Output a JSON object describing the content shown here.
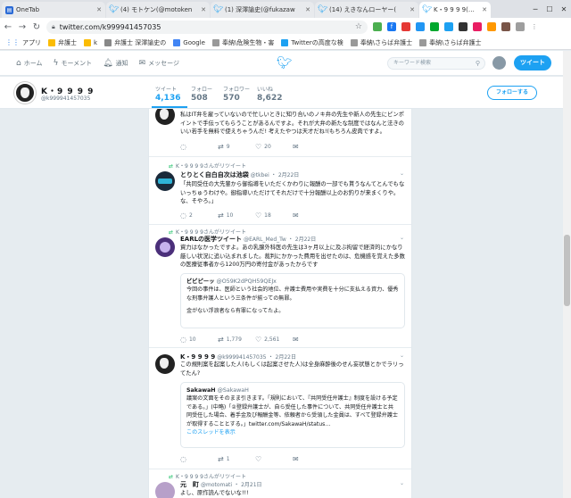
{
  "browser": {
    "tabs": [
      {
        "title": "OneTab",
        "icon": "onetab-icon",
        "active": false
      },
      {
        "title": "(4) モトケン(@motoken",
        "icon": "twitter-bird-icon",
        "active": false
      },
      {
        "title": "(1) 深澤諭史(@fukazaw",
        "icon": "twitter-bird-icon",
        "active": false
      },
      {
        "title": "(14) えきなんローヤー(",
        "icon": "twitter-bird-icon",
        "active": false
      },
      {
        "title": "K・9 9 9 9(@k99994145",
        "icon": "twitter-bird-icon",
        "active": true
      }
    ],
    "url": "twitter.com/k999941457035",
    "bookmarks": [
      "アプリ",
      "弁護士",
      "k",
      "弁護士 深澤諭史の",
      "Google",
      "奉納\\危険生物・害",
      "Twitterの高度な検",
      "奉納\\さらば弁護士",
      "奉納\\さらば弁護士"
    ]
  },
  "twitter_nav": {
    "home": "ホーム",
    "moments": "モーメント",
    "notifications": "通知",
    "messages": "メッセージ",
    "search_placeholder": "キーワード検索",
    "tweet_button": "ツイート"
  },
  "profile": {
    "name": "K・9 9 9 9",
    "handle": "@k999941457035",
    "stats": [
      {
        "label": "ツイート",
        "value": "4,136"
      },
      {
        "label": "フォロー",
        "value": "508"
      },
      {
        "label": "フォロワー",
        "value": "570"
      },
      {
        "label": "いいね",
        "value": "8,622"
      }
    ],
    "follow_button": "フォローする"
  },
  "tweets": [
    {
      "text": "私はIT弁を雇っていないので忙しいときに知り合いのノキ弁の先生や新人の先生にピンポイントで手伝ってもらうことがあるんですよ。それが大弁の新たな制度ではなんと法きのいい若手を無料で使えちゃうんだ! 考えたやつは天才だね!(もちろん皮肉ですよ。",
      "replies": "",
      "retweets": "9",
      "likes": "20"
    },
    {
      "retweeted_by": "K・9 9 9 9さんがリツイート",
      "name": "とりとく自白自次は池袋",
      "handle": "@tkbei",
      "date": "2月22日",
      "text": "「共同受任の大先輩から御指導をいただくかわりに報酬の一部でも貰うなんてとんでもないっちゅうわけや。御指導いただけてそれだけで十分報酬以上のお釣りが来まくりや。な、そやろ。」",
      "replies": "2",
      "retweets": "10",
      "likes": "18"
    },
    {
      "retweeted_by": "K・9 9 9 9さんがリツイート",
      "name": "EARLの医学ツイート",
      "handle": "@EARL_Med_Tw",
      "date": "2月22日",
      "text": "資力はなかったですよ。あの乳腺外科医の先生は3ヶ月以上に及ぶ拘留で経済的にかなり厳しい状況に追い込まれました。裁判にかかった費用を出せたのは、危機感を覚えた多数の医療従事者から1200万円の寄付金があったからです",
      "quote_name": "ビビピーッ",
      "quote_handle": "@O59K2dPQH59QEJx",
      "quote_text": "今回の事件は、医師という社会的地位、弁護士費用や実費を十分に支払える資力、優秀な刑事弁護人という三条件が揃っての無罪。",
      "quote_text2": "金がない浮浪者なら有罪になってたよ。",
      "replies": "10",
      "retweets": "1,779",
      "likes": "2,561"
    },
    {
      "name": "K・9 9 9 9",
      "handle": "@k999941457035",
      "date": "2月22日",
      "text": "この規則案を起案した人(もしくは起案させた人)は全身麻酔後のせん妄状態とかでラリってたん?",
      "quote_name": "SakawaH",
      "quote_handle": "@SakawaH",
      "quote_text": "議案の文面をそのまま引きます。「規則において、『共同受任弁護士』制度を設ける予定である。」(中略)「②登録弁護士が、自ら受任した事件について、共同受任弁護士と共同受任した場合、着手金及び報酬金等、依頼者から受領した金員は、すべて登録弁護士が取得することとする。」twitter.com/SakawaH/status…",
      "quote_link": "このスレッドを表示",
      "replies": "",
      "retweets": "1",
      "likes": ""
    },
    {
      "retweeted_by": "K・9 9 9 9さんがリツイート",
      "name": "元　町",
      "handle": "@motomati",
      "date": "2月21日",
      "text": "よし、原作読んでないな!!!"
    }
  ],
  "colors": {
    "twitter_blue": "#1da1f2",
    "retweet_green": "#17bf63",
    "muted_gray": "#657786"
  }
}
